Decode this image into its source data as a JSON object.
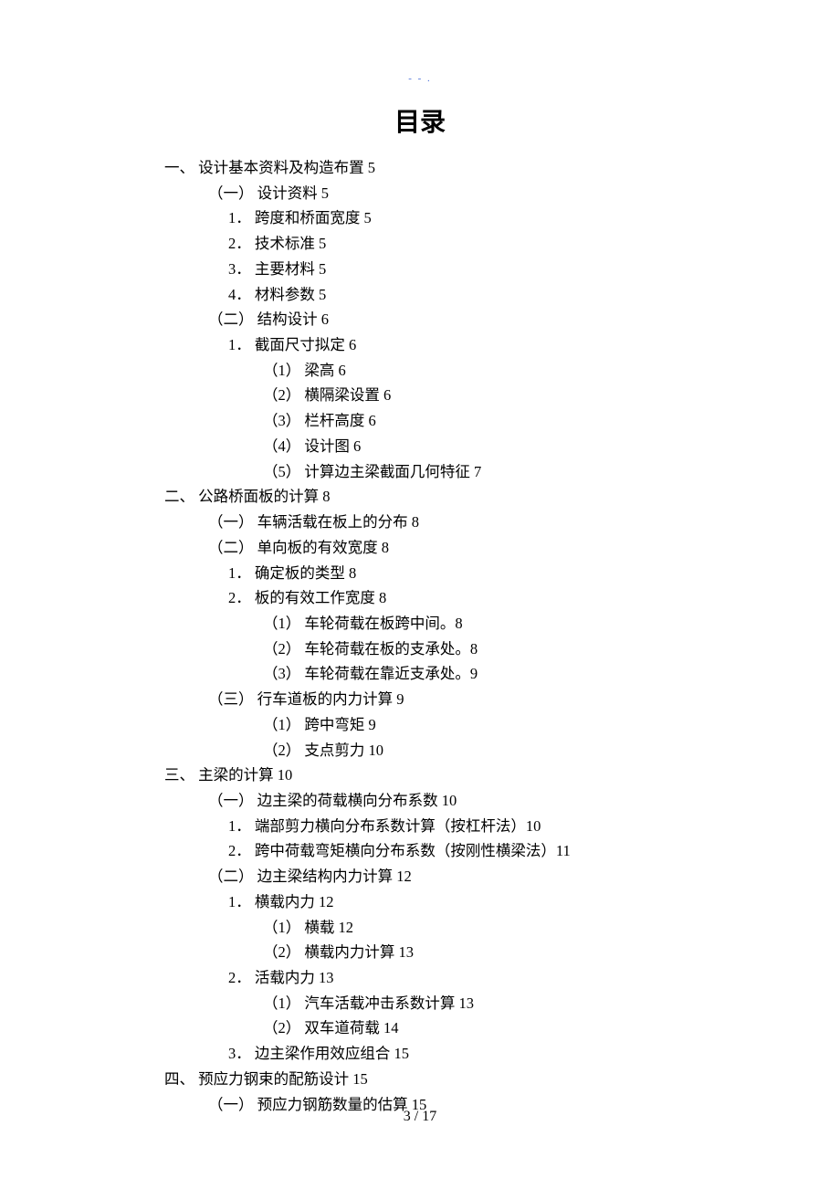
{
  "watermark": "- - .",
  "title": "目录",
  "toc": [
    {
      "level": 1,
      "text": "一、 设计基本资料及构造布置 5"
    },
    {
      "level": 2,
      "text": "（一） 设计资料 5"
    },
    {
      "level": 3,
      "text": "1． 跨度和桥面宽度 5"
    },
    {
      "level": 3,
      "text": "2． 技术标准 5"
    },
    {
      "level": 3,
      "text": "3． 主要材料 5"
    },
    {
      "level": 3,
      "text": "4． 材料参数 5"
    },
    {
      "level": 2,
      "text": "（二） 结构设计 6"
    },
    {
      "level": 3,
      "text": "1． 截面尺寸拟定 6"
    },
    {
      "level": 4,
      "text": "（1） 梁高 6"
    },
    {
      "level": 4,
      "text": "（2） 横隔梁设置 6"
    },
    {
      "level": 4,
      "text": "（3） 栏杆高度 6"
    },
    {
      "level": 4,
      "text": "（4） 设计图 6"
    },
    {
      "level": 4,
      "text": "（5） 计算边主梁截面几何特征 7"
    },
    {
      "level": 1,
      "text": "二、 公路桥面板的计算 8"
    },
    {
      "level": 2,
      "text": "（一） 车辆活载在板上的分布 8"
    },
    {
      "level": 2,
      "text": "（二） 单向板的有效宽度 8"
    },
    {
      "level": 3,
      "text": "1． 确定板的类型 8"
    },
    {
      "level": 3,
      "text": "2． 板的有效工作宽度 8"
    },
    {
      "level": 4,
      "text": "（1） 车轮荷载在板跨中间。8"
    },
    {
      "level": 4,
      "text": "（2） 车轮荷载在板的支承处。8"
    },
    {
      "level": 4,
      "text": "（3） 车轮荷载在靠近支承处。9"
    },
    {
      "level": 2,
      "text": "（三） 行车道板的内力计算 9"
    },
    {
      "level": 4,
      "text": "（1） 跨中弯矩 9"
    },
    {
      "level": 4,
      "text": "（2） 支点剪力 10"
    },
    {
      "level": 1,
      "text": "三、 主梁的计算 10"
    },
    {
      "level": 2,
      "text": "（一） 边主梁的荷载横向分布系数 10"
    },
    {
      "level": 3,
      "text": "1． 端部剪力横向分布系数计算（按杠杆法）10"
    },
    {
      "level": 3,
      "text": "2． 跨中荷载弯矩横向分布系数（按刚性横梁法）11"
    },
    {
      "level": 2,
      "text": "（二） 边主梁结构内力计算 12"
    },
    {
      "level": 3,
      "text": "1． 横载内力 12"
    },
    {
      "level": 4,
      "text": "（1） 横载 12"
    },
    {
      "level": 4,
      "text": "（2） 横载内力计算 13"
    },
    {
      "level": 3,
      "text": "2． 活载内力 13"
    },
    {
      "level": 4,
      "text": "（1） 汽车活载冲击系数计算 13"
    },
    {
      "level": 4,
      "text": "（2） 双车道荷载 14"
    },
    {
      "level": 3,
      "text": "3． 边主梁作用效应组合 15"
    },
    {
      "level": 1,
      "text": "四、 预应力钢束的配筋设计 15"
    },
    {
      "level": 2,
      "text": "（一） 预应力钢筋数量的估算 15"
    }
  ],
  "page_number": "3 / 17"
}
